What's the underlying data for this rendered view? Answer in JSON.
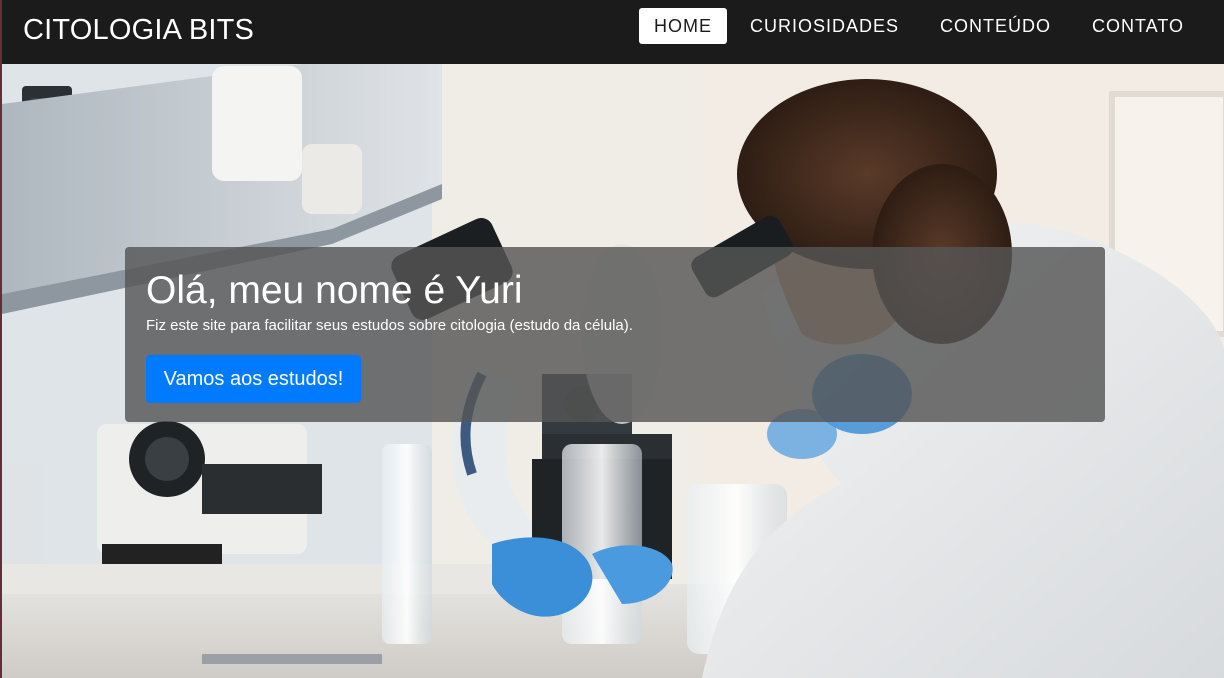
{
  "navbar": {
    "brand": "CITOLOGIA BITS",
    "items": [
      {
        "label": "HOME",
        "active": true
      },
      {
        "label": "CURIOSIDADES",
        "active": false
      },
      {
        "label": "CONTEÚDO",
        "active": false
      },
      {
        "label": "CONTATO",
        "active": false
      }
    ]
  },
  "hero": {
    "image": "lab-scientist-microscope-photo",
    "title": "Olá, meu nome é Yuri",
    "text": "Fiz este site para facilitar seus estudos sobre citologia (estudo da célula).",
    "button_label": "Vamos aos estudos!"
  },
  "colors": {
    "navbar_bg": "#1b1b1b",
    "button_primary": "#007bff",
    "overlay": "#555555"
  }
}
